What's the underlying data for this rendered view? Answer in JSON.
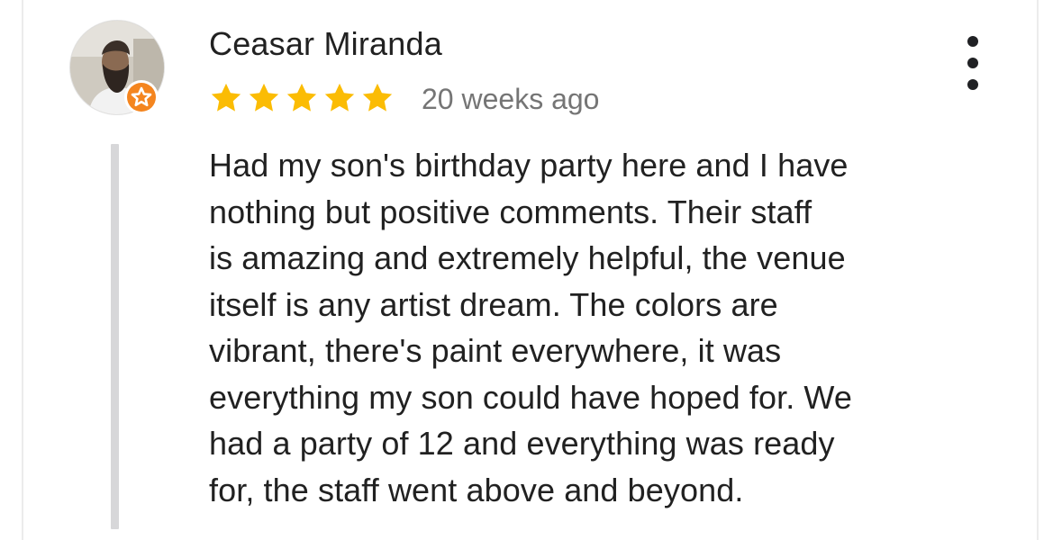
{
  "review": {
    "author_name": "Ceasar Miranda",
    "avatar": {
      "icon": "user-avatar-photo",
      "badge_icon": "local-guide-badge-icon",
      "badge_color": "#f4851f"
    },
    "rating": {
      "value": 5,
      "max": 5,
      "star_color": "#fbbc04"
    },
    "time_ago": "20 weeks ago",
    "menu_icon": "more-vert-icon",
    "text_lines": [
      "Had my son's birthday party here and I have",
      "nothing but positive comments. Their staff",
      "is amazing and extremely helpful, the venue",
      "itself is any artist dream. The colors are",
      "vibrant, there's paint everywhere, it was",
      "everything my son could have hoped for. We",
      "had a party of 12 and everything was ready",
      "for, the staff went above and beyond."
    ]
  }
}
